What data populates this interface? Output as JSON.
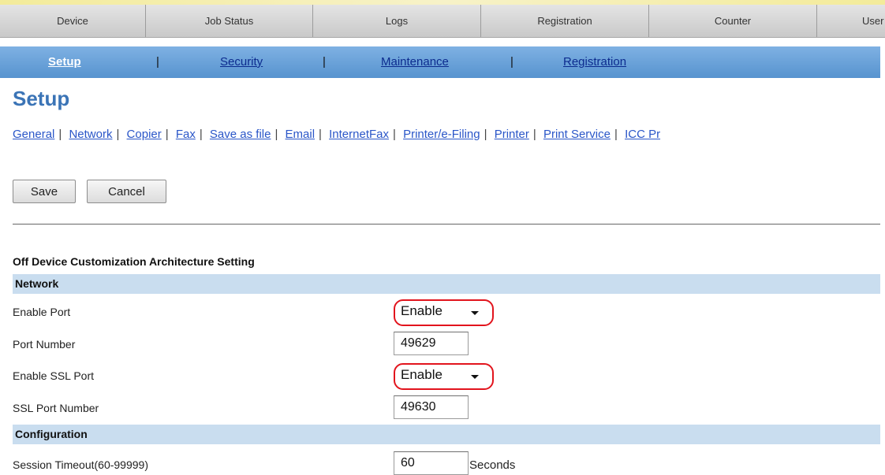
{
  "top_tabs": [
    "Device",
    "Job Status",
    "Logs",
    "Registration",
    "Counter",
    "User I"
  ],
  "sub_nav": {
    "items": [
      "Setup",
      "Security",
      "Maintenance",
      "Registration"
    ],
    "separator": "|"
  },
  "page_title": "Setup",
  "section_nav": {
    "links": [
      "General",
      "Network",
      "Copier",
      "Fax",
      "Save as file",
      "Email",
      "InternetFax",
      "Printer/e-Filing",
      "Printer",
      "Print Service",
      "ICC Pr"
    ],
    "separator": "|"
  },
  "buttons": {
    "save": "Save",
    "cancel": "Cancel"
  },
  "form": {
    "title": "Off Device Customization Architecture Setting",
    "network_header": "Network",
    "enable_port_label": "Enable Port",
    "enable_port_value": "Enable",
    "port_number_label": "Port Number",
    "port_number_value": "49629",
    "enable_ssl_port_label": "Enable SSL Port",
    "enable_ssl_port_value": "Enable",
    "ssl_port_number_label": "SSL Port Number",
    "ssl_port_number_value": "49630",
    "configuration_header": "Configuration",
    "session_timeout_label": "Session Timeout(60-99999)",
    "session_timeout_value": "60",
    "session_timeout_unit": "Seconds"
  },
  "colors": {
    "subnav": "#6aa3dc",
    "section_header": "#c9ddef",
    "highlight_ring": "#e2141d",
    "title": "#3b74b6"
  }
}
